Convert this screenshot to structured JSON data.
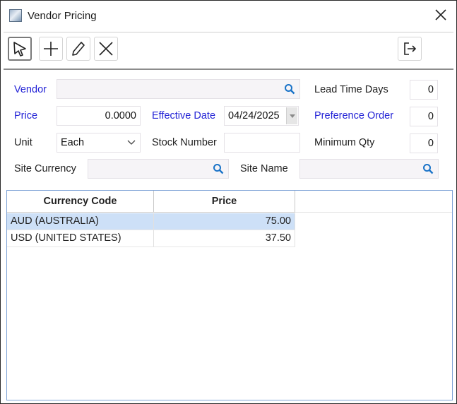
{
  "window": {
    "title": "Vendor Pricing",
    "app_icon": "window-app-icon",
    "close_glyph": "✕"
  },
  "toolbar": {
    "buttons": [
      {
        "name": "select-button",
        "icon": "pointer-arrow-icon",
        "active": true
      },
      {
        "name": "add-button",
        "icon": "plus-icon",
        "active": false
      },
      {
        "name": "edit-button",
        "icon": "pencil-icon",
        "active": false
      },
      {
        "name": "delete-button",
        "icon": "close-x-icon",
        "active": false
      },
      {
        "name": "exit-button",
        "icon": "exit-door-icon",
        "active": false
      }
    ]
  },
  "form": {
    "vendor_label": "Vendor",
    "vendor_value": "",
    "price_label": "Price",
    "price_value": "0.0000",
    "effective_date_label": "Effective Date",
    "effective_date_value": "04/24/2025",
    "unit_label": "Unit",
    "unit_value": "Each",
    "stock_number_label": "Stock Number",
    "stock_number_value": "",
    "site_currency_label": "Site Currency",
    "site_currency_value": "",
    "site_name_label": "Site Name",
    "site_name_value": "",
    "lead_time_label": "Lead Time Days",
    "lead_time_value": "0",
    "preference_order_label": "Preference Order",
    "preference_order_value": "0",
    "minimum_qty_label": "Minimum Qty",
    "minimum_qty_value": "0"
  },
  "grid": {
    "columns": [
      "Currency Code",
      "Price"
    ],
    "rows": [
      {
        "currency": "AUD (AUSTRALIA)",
        "price": "75.00",
        "selected": true
      },
      {
        "currency": "USD (UNITED STATES)",
        "price": "37.50",
        "selected": false
      }
    ]
  },
  "colors": {
    "required_label": "#2323d6",
    "selected_row": "#cde0f7",
    "grid_border": "#7da2d6",
    "search_icon": "#1a73c8"
  }
}
